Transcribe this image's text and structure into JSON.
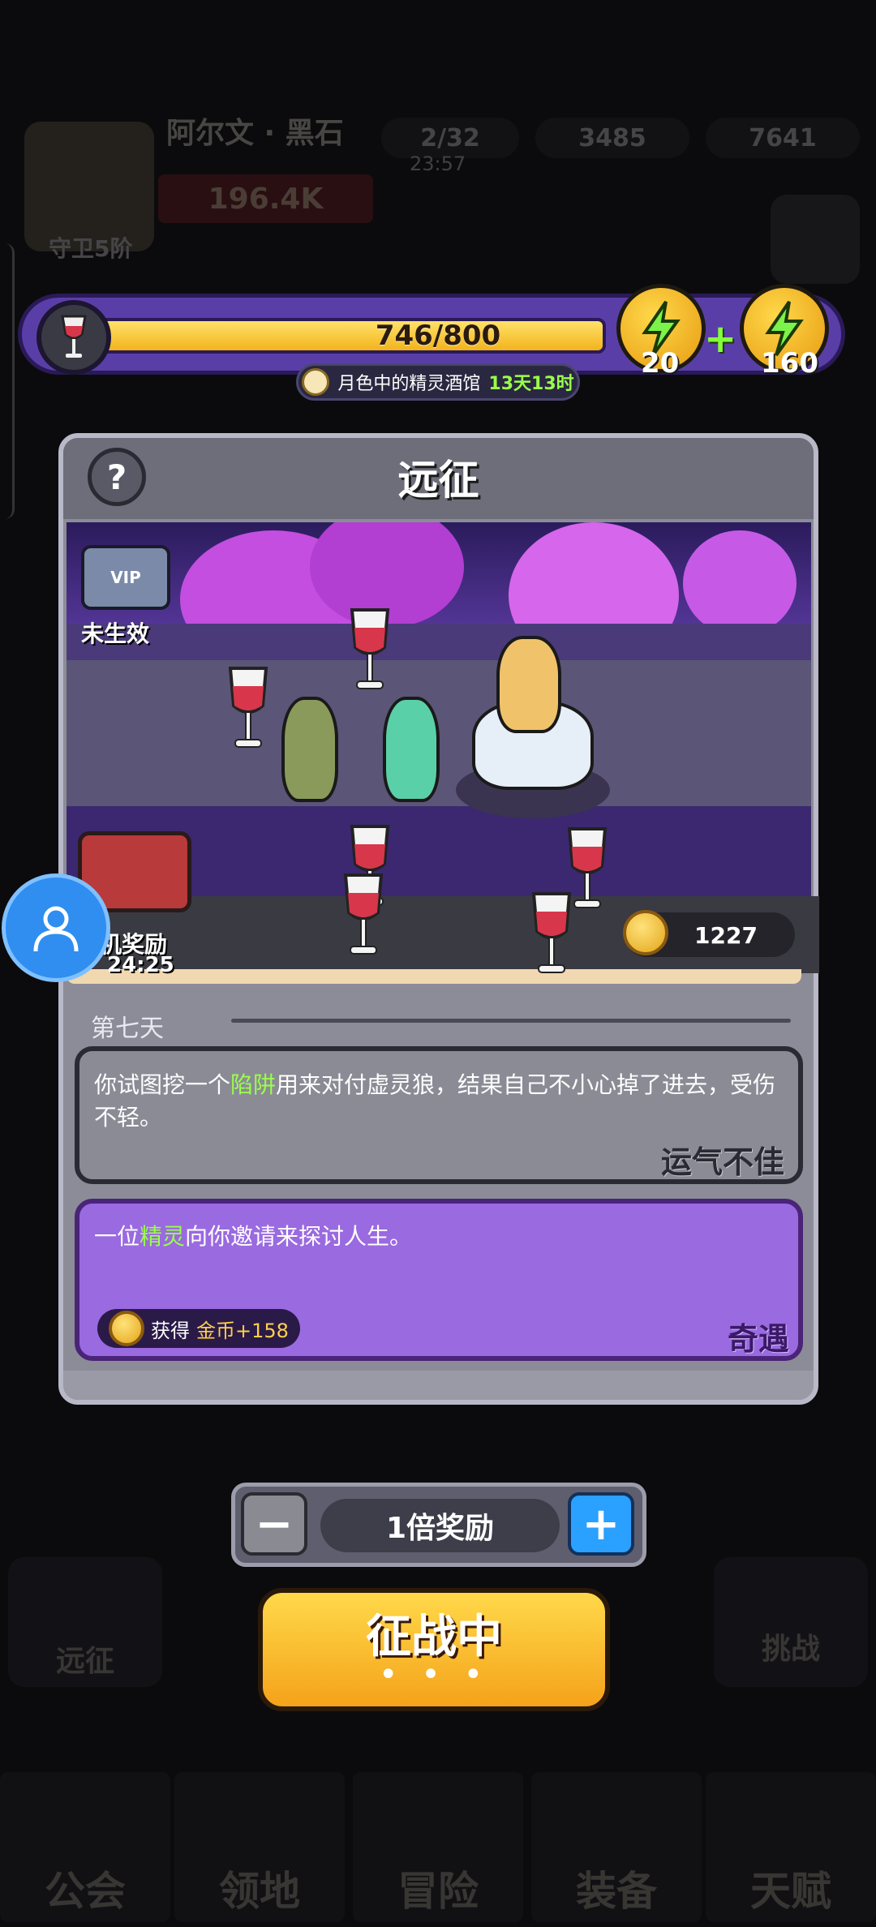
{
  "background_hud": {
    "player_name": "阿尔文 · 黑石",
    "stamina": "2/32",
    "stamina_timer": "23:57",
    "gems": "3485",
    "coins": "7641",
    "power": "196.4K",
    "rank": "守卫5阶",
    "bottom_tabs": [
      "公会",
      "领地",
      "冒险",
      "装备",
      "天赋"
    ],
    "side_left": "远征",
    "side_right": "挑战"
  },
  "energy": {
    "current": 746,
    "max": 800,
    "label": "746/800",
    "fill_fraction": 0.9325,
    "boost_small": "20",
    "boost_large": "160",
    "plus": "+",
    "tavern_name": "月色中的精灵酒馆",
    "tavern_time": "13天13时"
  },
  "panel": {
    "title": "远征",
    "help": "?",
    "vip_status": "未生效",
    "vip_badge": "VIP",
    "afk_label": "机奖励",
    "afk_time": "24:25",
    "gold_amount": "1227",
    "day_label": "第七天"
  },
  "events": [
    {
      "text_before": "你试图挖一个",
      "highlight": "陷阱",
      "text_after": "用来对付虚灵狼，结果自己不小心掉了进去，受伤不轻。",
      "tag": "运气不佳"
    },
    {
      "text_before": "一位",
      "highlight": "精灵",
      "text_after": "向你邀请来探讨人生。",
      "tag": "奇遇",
      "reward_prefix": "获得",
      "reward_item": "金币+158"
    }
  ],
  "multiplier": {
    "minus": "−",
    "plus": "+",
    "label": "1倍奖励"
  },
  "action": {
    "label": "征战中",
    "dots": "• • •"
  },
  "colors": {
    "energy_frame": "#5a3ea8",
    "energy_fill": "#f2b31c",
    "highlight_text": "#9aff4a",
    "event_purple": "#9a6ae0",
    "action_button": "#f5a21a",
    "plus_button": "#2aa0ff"
  }
}
